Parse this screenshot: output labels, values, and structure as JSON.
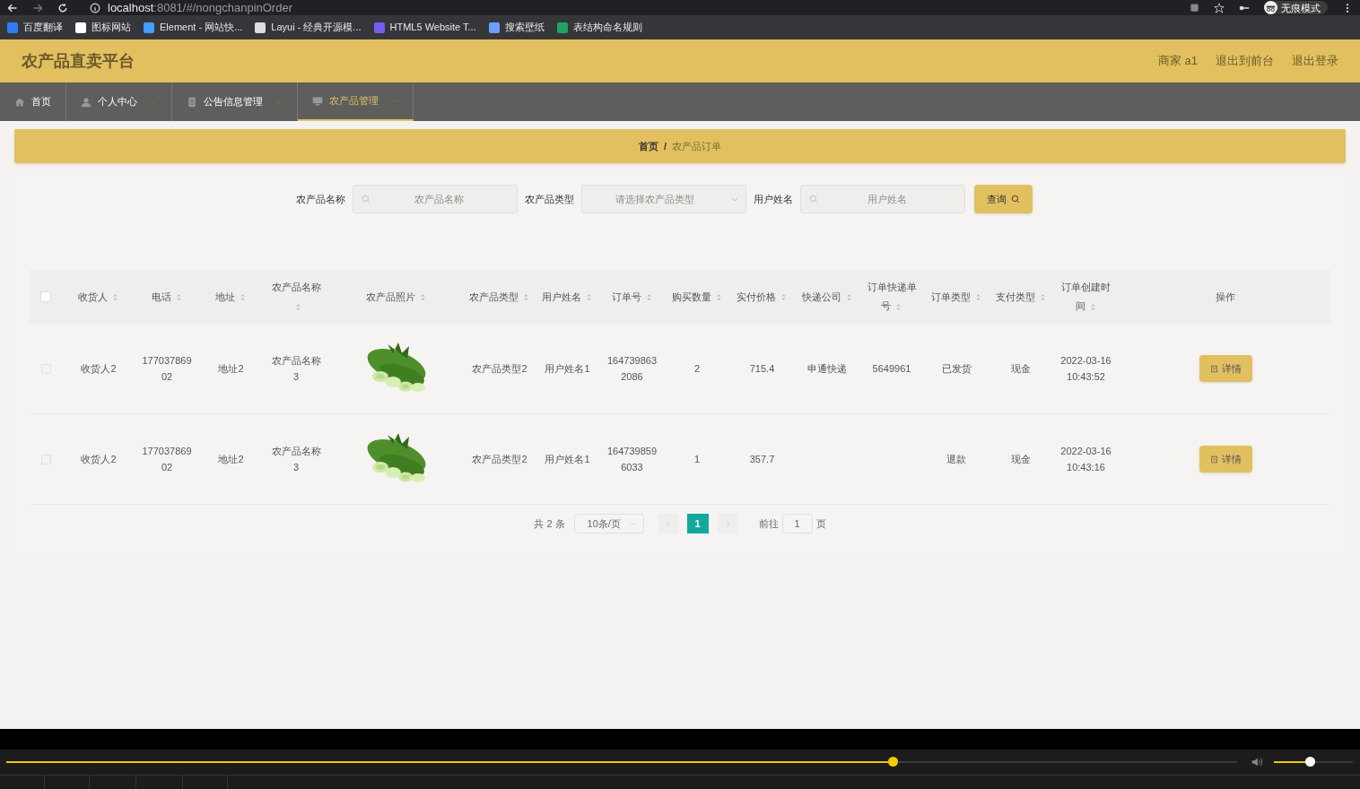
{
  "browser": {
    "url_host": "localhost",
    "url_path": ":8081/#/nongchanpinOrder",
    "profile": "无痕模式",
    "bookmarks": [
      {
        "label": "百度翻译",
        "color": "#2f7df6"
      },
      {
        "label": "图标网站",
        "color": "#ffffff"
      },
      {
        "label": "Element - 网站快...",
        "color": "#409eff"
      },
      {
        "label": "Layui - 经典开源模...",
        "color": "#dddddd"
      },
      {
        "label": "HTML5 Website T...",
        "color": "#7b5cf0"
      },
      {
        "label": "搜索壁纸",
        "color": "#6aa0ff"
      },
      {
        "label": "表结构命名规则",
        "color": "#1fa463"
      }
    ]
  },
  "header": {
    "title": "农产品直卖平台",
    "links": [
      "商家 a1",
      "退出到前台",
      "退出登录"
    ]
  },
  "nav": [
    {
      "label": "首页",
      "selected": false,
      "dropdown": false
    },
    {
      "label": "个人中心",
      "selected": false,
      "dropdown": true
    },
    {
      "label": "公告信息管理",
      "selected": false,
      "dropdown": true
    },
    {
      "label": "农产品管理",
      "selected": true,
      "dropdown": true
    }
  ],
  "breadcrumb": {
    "separator": "/",
    "items": [
      "首页",
      "农产品订单"
    ]
  },
  "search": {
    "fields": [
      {
        "label": "农产品名称",
        "kind": "input",
        "placeholder": "农产品名称"
      },
      {
        "label": "农产品类型",
        "kind": "select",
        "placeholder": "请选择农产品类型"
      },
      {
        "label": "用户姓名",
        "kind": "input",
        "placeholder": "用户姓名"
      }
    ],
    "button": "查询"
  },
  "table": {
    "all_checked": false,
    "columns": [
      {
        "label": "收货人",
        "sortable": true
      },
      {
        "label": "电话",
        "sortable": true
      },
      {
        "label": "地址",
        "sortable": true
      },
      {
        "label": "农产品名称",
        "sortable": true
      },
      {
        "label": "农产品照片",
        "sortable": true
      },
      {
        "label": "农产品类型",
        "sortable": true
      },
      {
        "label": "用户姓名",
        "sortable": true
      },
      {
        "label": "订单号",
        "sortable": true
      },
      {
        "label": "购买数量",
        "sortable": true
      },
      {
        "label": "实付价格",
        "sortable": true
      },
      {
        "label": "快递公司",
        "sortable": true
      },
      {
        "label": "订单快递单号",
        "sortable": true
      },
      {
        "label": "订单类型",
        "sortable": true
      },
      {
        "label": "支付类型",
        "sortable": true
      },
      {
        "label": "订单创建时间",
        "sortable": true
      },
      {
        "label": "操作",
        "sortable": false
      }
    ],
    "rows": [
      {
        "checked": false,
        "cells": [
          "收货人2",
          "17703786902",
          "地址2",
          "农产品名称3",
          {
            "kind": "picture"
          },
          "农产品类型2",
          "用户姓名1",
          "1647398632086",
          "2",
          "715.4",
          "申通快递",
          "5649961",
          "已发货",
          "现金",
          "2022-03-16 10:43:52"
        ],
        "action": "详情"
      },
      {
        "checked": false,
        "cells": [
          "收货人2",
          "17703786902",
          "地址2",
          "农产品名称3",
          {
            "kind": "picture"
          },
          "农产品类型2",
          "用户姓名1",
          "1647398596033",
          "1",
          "357.7",
          "",
          "",
          "退款",
          "现金",
          "2022-03-16 10:43:16"
        ],
        "action": "详情"
      }
    ]
  },
  "pagination": {
    "total": "共 2 条",
    "page_size": "10条/页",
    "pages": [
      {
        "label": "1",
        "selected": true
      }
    ],
    "goto_label": "前往",
    "goto_value": "1",
    "goto_suffix": "页"
  },
  "player": {
    "progress": {
      "level": 0.72
    },
    "volume": {
      "level": 0.45
    }
  }
}
